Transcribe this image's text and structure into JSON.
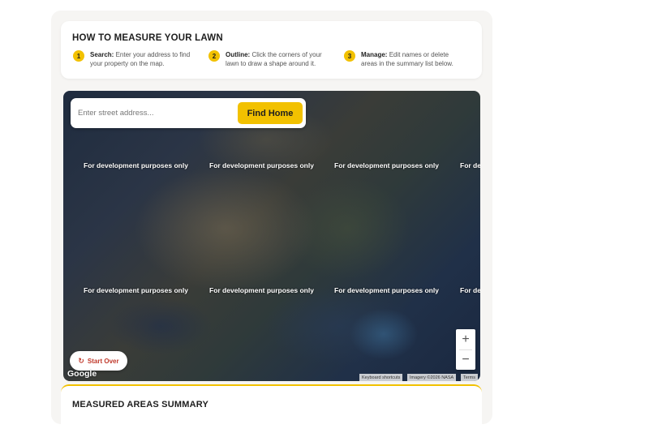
{
  "howto": {
    "title": "HOW TO MEASURE YOUR LAWN",
    "steps": [
      {
        "num": "1",
        "label": "Search:",
        "text": "Enter your address to find your property on the map."
      },
      {
        "num": "2",
        "label": "Outline:",
        "text": "Click the corners of your lawn to draw a shape around it."
      },
      {
        "num": "3",
        "label": "Manage:",
        "text": "Edit names or delete areas in the summary list below."
      }
    ]
  },
  "search": {
    "placeholder": "Enter street address...",
    "button_label": "Find Home"
  },
  "map": {
    "dev_watermark": "For development purposes only",
    "dev_watermark_cut": "For dev",
    "zoom_in": "+",
    "zoom_out": "−",
    "start_over": "Start Over",
    "google_logo": "Google",
    "attribution": {
      "keyboard": "Keyboard shortcuts",
      "imagery": "Imagery ©2026 NASA",
      "terms": "Terms"
    }
  },
  "summary": {
    "title": "MEASURED AREAS SUMMARY"
  },
  "colors": {
    "accent": "#f2c100",
    "danger": "#c0392b"
  }
}
